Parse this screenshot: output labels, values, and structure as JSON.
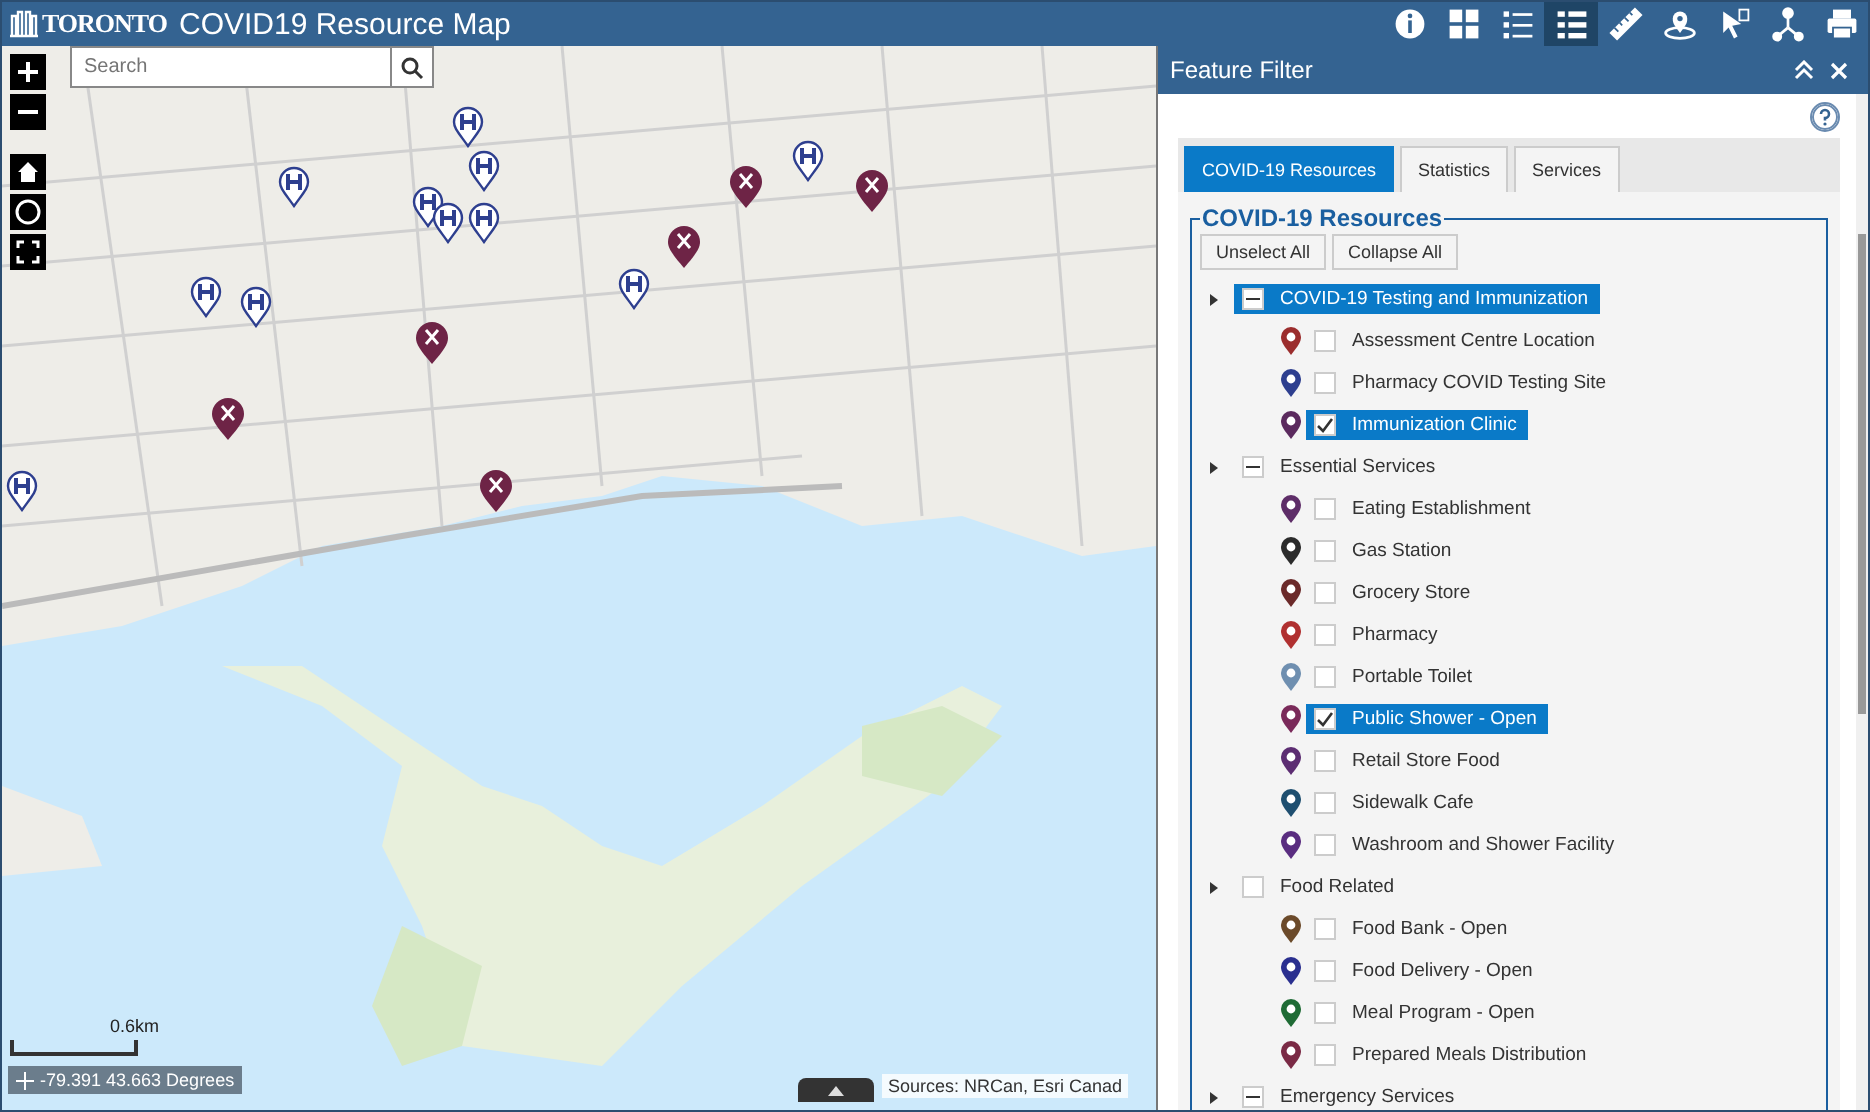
{
  "header": {
    "logo": "TORONTO",
    "title": "COVID19 Resource Map",
    "tools": [
      {
        "kind": "info",
        "selected": false
      },
      {
        "kind": "grid",
        "selected": false
      },
      {
        "kind": "list",
        "selected": false
      },
      {
        "kind": "filter",
        "selected": true
      },
      {
        "kind": "ruler",
        "selected": false
      },
      {
        "kind": "pin",
        "selected": false
      },
      {
        "kind": "cursor",
        "selected": false
      },
      {
        "kind": "network",
        "selected": false
      },
      {
        "kind": "print",
        "selected": false
      }
    ]
  },
  "map": {
    "search": {
      "placeholder": "Search"
    },
    "scale": "0.6km",
    "coordinates": "-79.391 43.663 Degrees",
    "attribution": "Sources: NRCan, Esri Canad"
  },
  "panel": {
    "title": "Feature Filter",
    "tabs": [
      {
        "label": "COVID-19 Resources",
        "selected": true
      },
      {
        "label": "Statistics",
        "selected": false
      },
      {
        "label": "Services",
        "selected": false
      }
    ],
    "legend": "COVID-19 Resources",
    "buttons": [
      "Unselect All",
      "Collapse All"
    ],
    "groups": [
      {
        "label": "COVID-19 Testing and Immunization",
        "partial": true,
        "selected": true,
        "children": [
          {
            "label": "Assessment Centre Location",
            "checked": false,
            "color": "#9b2d2d"
          },
          {
            "label": "Pharmacy COVID Testing Site",
            "checked": false,
            "color": "#2e3f8f"
          },
          {
            "label": "Immunization Clinic",
            "checked": true,
            "color": "#5b2a5e"
          }
        ]
      },
      {
        "label": "Essential Services",
        "partial": true,
        "selected": false,
        "children": [
          {
            "label": "Eating Establishment",
            "checked": false,
            "color": "#5e2d68"
          },
          {
            "label": "Gas Station",
            "checked": false,
            "color": "#2b2b2b"
          },
          {
            "label": "Grocery Store",
            "checked": false,
            "color": "#6b2a2a"
          },
          {
            "label": "Pharmacy",
            "checked": false,
            "color": "#b03030"
          },
          {
            "label": "Portable Toilet",
            "checked": false,
            "color": "#6f8fb0"
          },
          {
            "label": "Public Shower - Open",
            "checked": true,
            "color": "#7a2a5a"
          },
          {
            "label": "Retail Store Food",
            "checked": false,
            "color": "#5c2d72"
          },
          {
            "label": "Sidewalk Cafe",
            "checked": false,
            "color": "#1f4f70"
          },
          {
            "label": "Washroom and Shower Facility",
            "checked": false,
            "color": "#5a2d80"
          }
        ]
      },
      {
        "label": "Food Related",
        "partial": false,
        "selected": false,
        "children": [
          {
            "label": "Food Bank - Open",
            "checked": false,
            "color": "#6b4a2a"
          },
          {
            "label": "Food Delivery - Open",
            "checked": false,
            "color": "#2a2f8f"
          },
          {
            "label": "Meal Program - Open",
            "checked": false,
            "color": "#1f6b35"
          },
          {
            "label": "Prepared Meals Distribution",
            "checked": false,
            "color": "#7a2a45"
          }
        ]
      },
      {
        "label": "Emergency Services",
        "partial": true,
        "selected": false
      }
    ]
  }
}
